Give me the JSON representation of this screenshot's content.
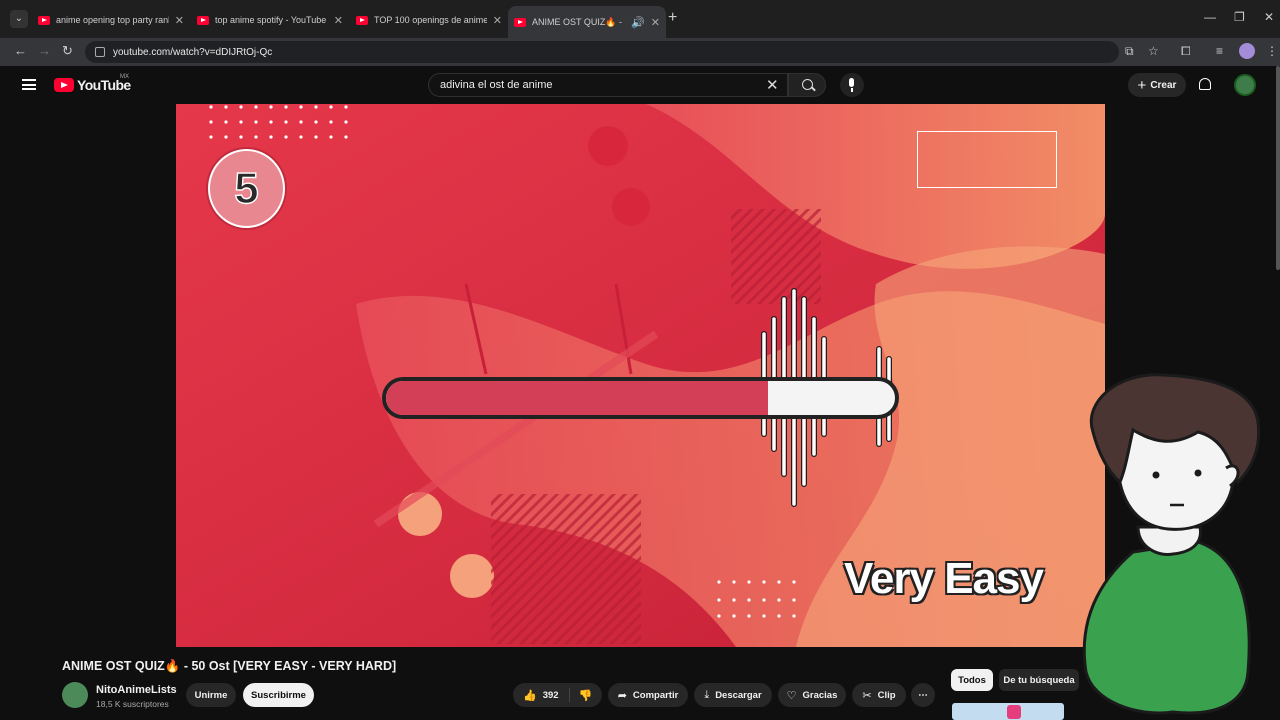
{
  "browser": {
    "tabs": [
      {
        "title": "anime opening top party rank",
        "active": false
      },
      {
        "title": "top anime spotify - YouTube",
        "active": false
      },
      {
        "title": "TOP 100 openings de anime m",
        "active": false
      },
      {
        "title": "ANIME OST QUIZ🔥 - 50 O",
        "active": true
      }
    ],
    "url": "youtube.com/watch?v=dDIJRtOj-Qc"
  },
  "youtube": {
    "logo_text": "YouTube",
    "country_code": "MX",
    "search_query": "adivina el ost de anime",
    "create_label": "Crear"
  },
  "video": {
    "timer": "5",
    "progress": 0.75,
    "difficulty": "Very Easy",
    "colors": {
      "bg": "#d62a40",
      "accent": "#f08a5d",
      "bar_fill": "#d43f58"
    }
  },
  "info": {
    "title": "ANIME OST QUIZ🔥 - 50 Ost [VERY EASY - VERY HARD]",
    "channel": "NitoAnimeLists",
    "subscribers": "18,5 K suscriptores",
    "join_label": "Unirme",
    "subscribe_label": "Suscribirme",
    "likes": "392",
    "share_label": "Compartir",
    "download_label": "Descargar",
    "thanks_label": "Gracias",
    "clip_label": "Clip",
    "more_label": "⋯"
  },
  "filters": {
    "all_label": "Todos",
    "search_label": "De tu búsqueda"
  }
}
